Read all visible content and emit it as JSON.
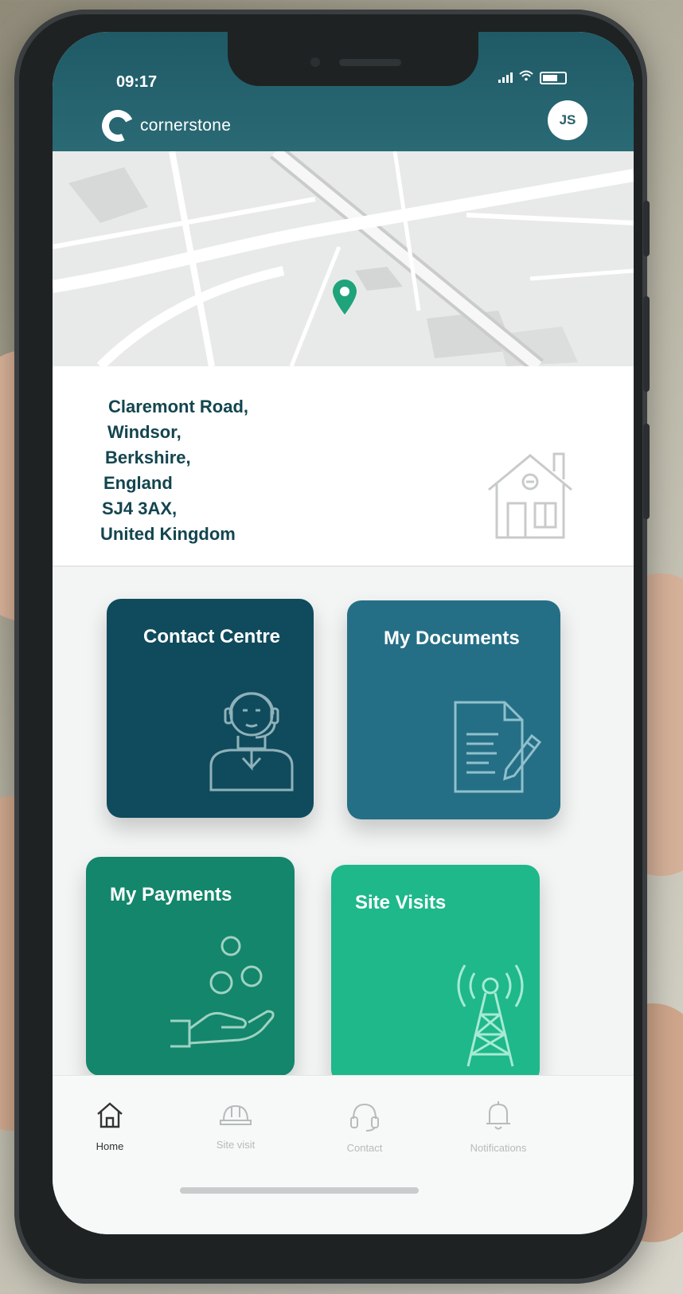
{
  "status_bar": {
    "time": "09:17"
  },
  "header": {
    "logo_text": "cornerstone",
    "avatar_initials": "JS"
  },
  "address": {
    "lines": [
      "Claremont Road,",
      "Windsor,",
      "Berkshire,",
      "England",
      "SJ4 3AX,",
      "United Kingdom"
    ]
  },
  "tiles": [
    {
      "label": "Contact Centre",
      "icon": "agent-headset-icon"
    },
    {
      "label": "My Documents",
      "icon": "document-edit-icon"
    },
    {
      "label": "My Payments",
      "icon": "hand-coins-icon"
    },
    {
      "label": "Site Visits",
      "icon": "radio-tower-icon"
    }
  ],
  "nav": {
    "items": [
      {
        "label": "Home",
        "icon": "home-icon",
        "active": true
      },
      {
        "label": "Site visit",
        "icon": "hard-hat-icon",
        "active": false
      },
      {
        "label": "Contact",
        "icon": "headphones-icon",
        "active": false
      },
      {
        "label": "Notifications",
        "icon": "bell-icon",
        "active": false
      }
    ]
  },
  "colors": {
    "header": "#1f5a66",
    "contact_tile": "#0f4b5c",
    "documents_tile": "#256f86",
    "payments_tile": "#13866b",
    "visits_tile": "#1eb88a",
    "map_pin": "#1fa37a"
  }
}
